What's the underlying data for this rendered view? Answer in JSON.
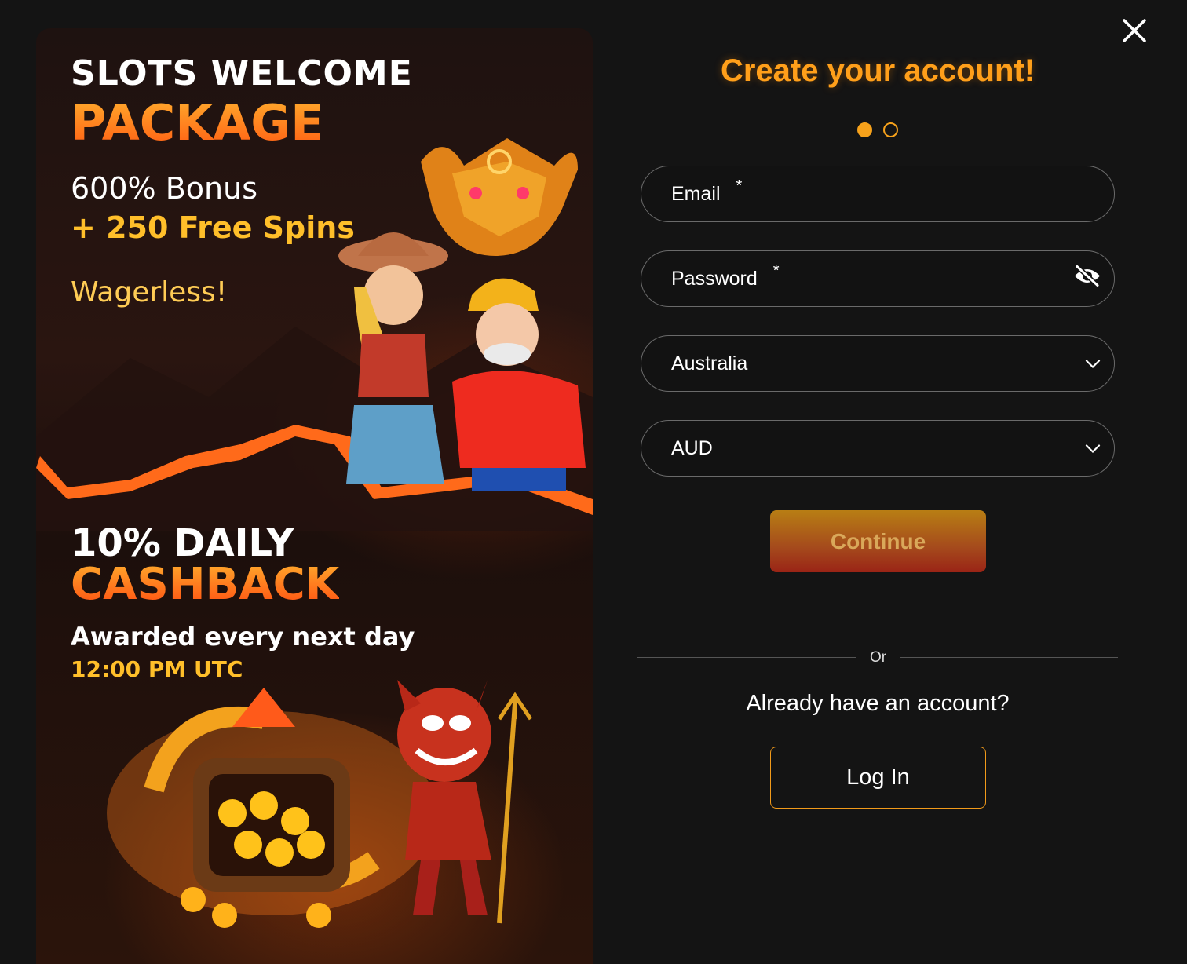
{
  "promo": {
    "headline_line1": "SLOTS WELCOME",
    "headline_line2": "PACKAGE",
    "bonus": "600% Bonus",
    "free_spins": "+ 250 Free Spins",
    "wagerless": "Wagerless!",
    "cashback_line1": "10% DAILY",
    "cashback_line2": "CASHBACK",
    "awarded": "Awarded every next day",
    "time": "12:00 PM UTC"
  },
  "form": {
    "title": "Create your account!",
    "steps": {
      "current": 1,
      "total": 2
    },
    "email_label": "Email",
    "password_label": "Password",
    "required_marker": "*",
    "country_value": "Australia",
    "currency_value": "AUD",
    "continue_label": "Continue",
    "or_label": "Or",
    "already_text": "Already have an account?",
    "login_label": "Log In"
  },
  "icons": {
    "close": "close-icon",
    "password_toggle": "eye-slash-icon",
    "dropdown": "chevron-down-icon"
  },
  "colors": {
    "accent": "#f7a21b",
    "title": "#ff9f1a",
    "background": "#141414"
  }
}
